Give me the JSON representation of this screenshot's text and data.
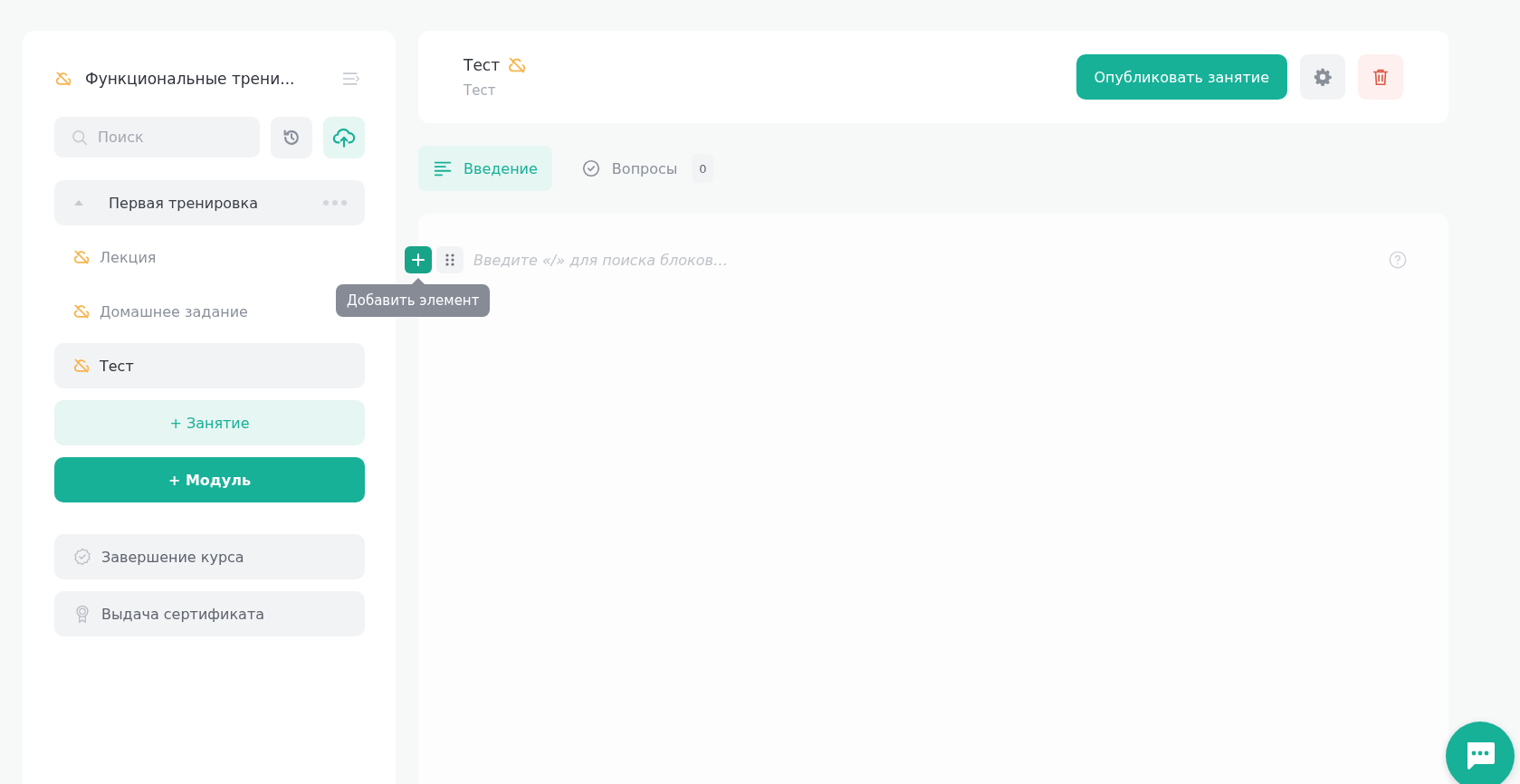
{
  "sidebar": {
    "course_title": "Функциональные трени...",
    "course_published": false,
    "search": {
      "placeholder": "Поиск"
    },
    "modules": [
      {
        "title": "Первая тренировка",
        "expanded": true,
        "lessons": [
          {
            "title": "Лекция",
            "published": false,
            "selected": false
          },
          {
            "title": "Домашнее задание",
            "published": false,
            "selected": false
          },
          {
            "title": "Тест",
            "published": false,
            "selected": true
          }
        ]
      }
    ],
    "add_lesson": "+ Занятие",
    "add_module": "+ Модуль",
    "extras": [
      {
        "kind": "completion",
        "title": "Завершение курса"
      },
      {
        "kind": "certificate",
        "title": "Выдача сертификата"
      }
    ]
  },
  "header": {
    "title": "Тест",
    "published": false,
    "subtitle": "Тест",
    "publish_button": "Опубликовать занятие"
  },
  "tabs": [
    {
      "kind": "intro",
      "label": "Введение",
      "selected": true
    },
    {
      "kind": "questions",
      "label": "Вопросы",
      "selected": false,
      "count": "0"
    }
  ],
  "editor": {
    "placeholder": "Введите «/» для поиска блоков…",
    "tooltip": "Добавить элемент"
  }
}
